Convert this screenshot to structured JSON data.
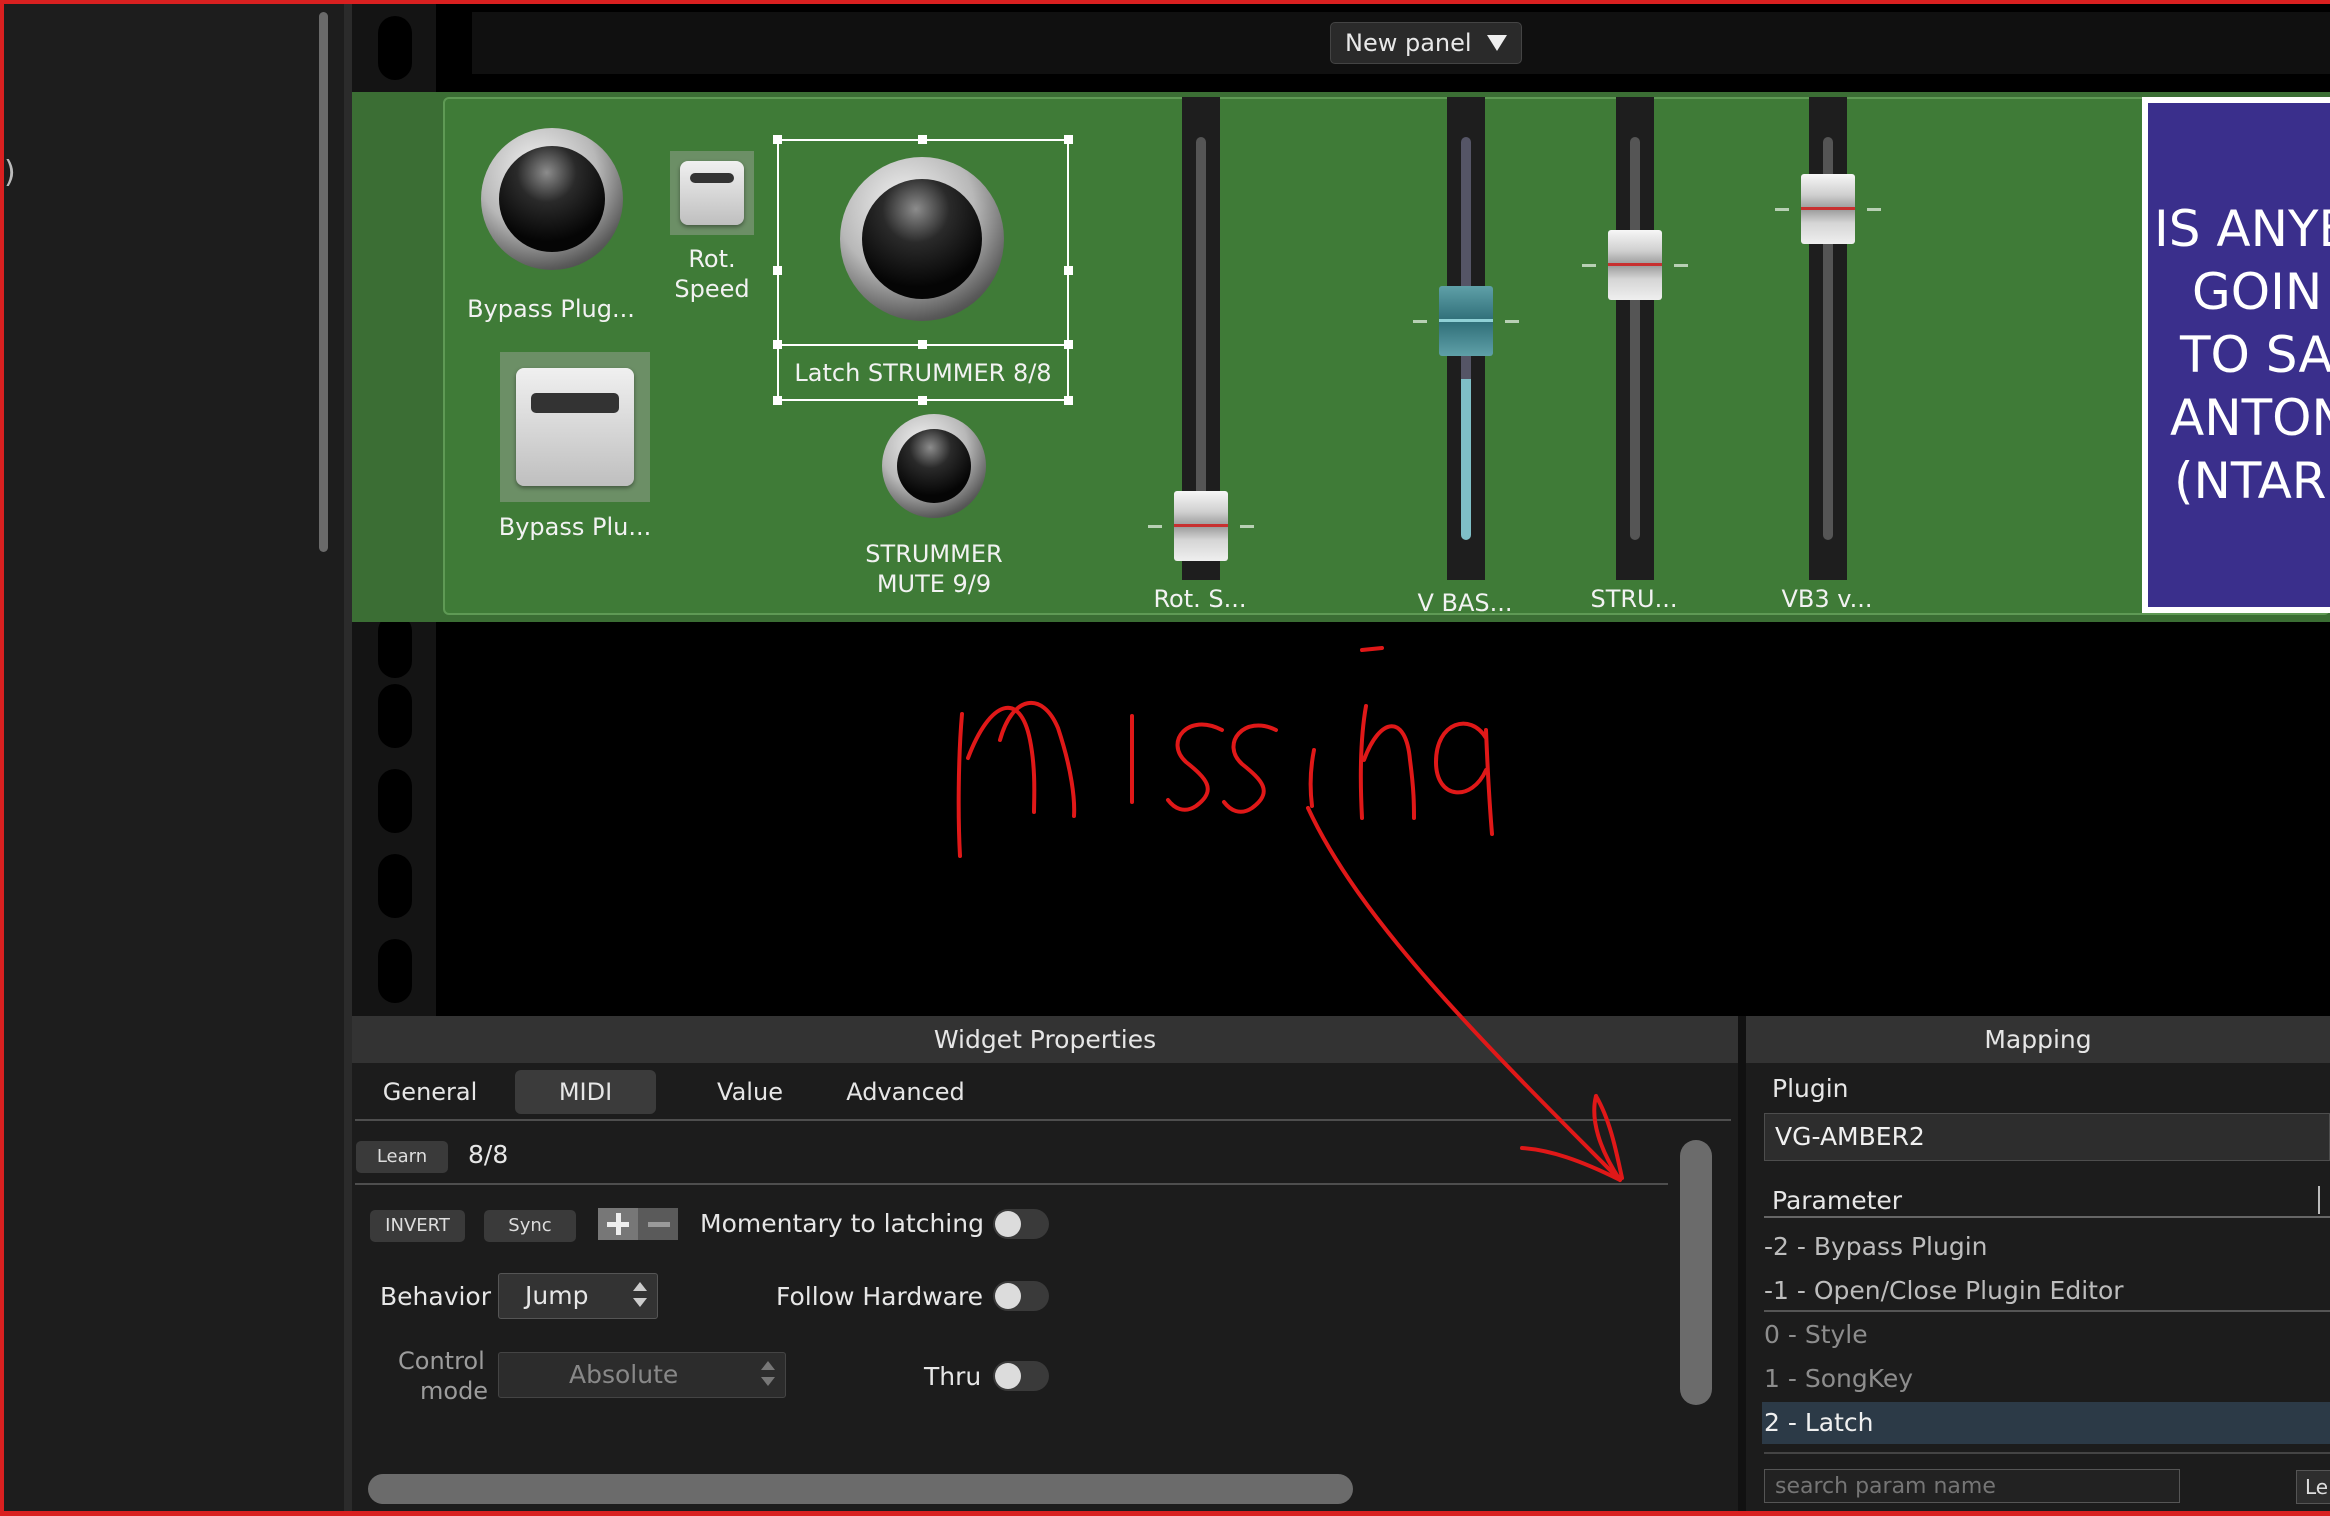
{
  "toolbar": {
    "panel_select": "New panel"
  },
  "left": {
    "glyph": ")"
  },
  "rack": {
    "widgets": {
      "bypass_knob_label": "Bypass Plug...",
      "rot_speed_label_1": "Rot.",
      "rot_speed_label_2": "Speed",
      "latch_label": "Latch STRUMMER 8/8",
      "bypass_switch_label": "Bypass Plu...",
      "mute_label_1": "STRUMMER",
      "mute_label_2": "MUTE 9/9"
    },
    "faders": [
      {
        "label": "Rot. S...",
        "level": 0.05
      },
      {
        "label": "V BAS...",
        "level": 0.6
      },
      {
        "label": "STRU...",
        "level": 0.75
      },
      {
        "label": "VB3 v...",
        "level": 0.9
      }
    ],
    "lyrics": [
      "IS ANYBO",
      "GOIN",
      "TO SA",
      "ANTON",
      "(NTAR"
    ]
  },
  "annotation": {
    "text": "missing",
    "color": "#e01818"
  },
  "widget_properties": {
    "title": "Widget Properties",
    "tabs": {
      "general": "General",
      "midi": "MIDI",
      "value": "Value",
      "advanced": "Advanced"
    },
    "learn_label": "Learn",
    "midi_value": "8/8",
    "invert_label": "INVERT",
    "sync_label": "Sync",
    "momentary_label": "Momentary to latching",
    "behavior_label": "Behavior",
    "behavior_value": "Jump",
    "follow_label": "Follow Hardware",
    "control_mode_label_1": "Control",
    "control_mode_label_2": "mode",
    "control_mode_value": "Absolute",
    "thru_label": "Thru"
  },
  "mapping": {
    "title": "Mapping",
    "plugin_label": "Plugin",
    "plugin_value": "VG-AMBER2",
    "parameter_label": "Parameter",
    "params": [
      "-2 - Bypass Plugin",
      "-1 - Open/Close Plugin Editor",
      "0 - Style",
      "1 - SongKey",
      "2 - Latch"
    ],
    "search_placeholder": "search param name",
    "learn_label": "Le"
  },
  "colors": {
    "rack_green": "#3f7b37",
    "lyric_bg": "#3a2f8c",
    "selected_row": "#2c3a47"
  }
}
